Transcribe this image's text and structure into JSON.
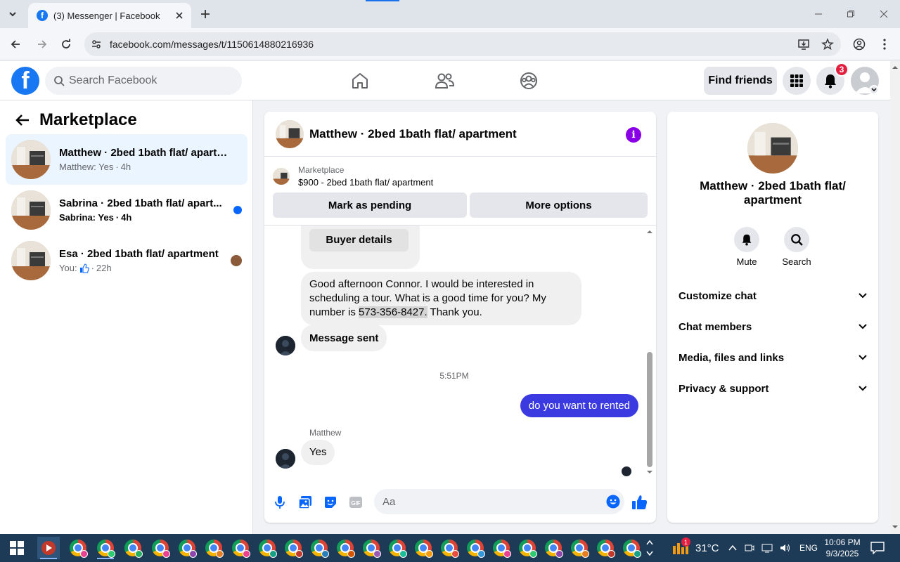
{
  "browser": {
    "tab_title": "(3) Messenger | Facebook",
    "url": "facebook.com/messages/t/1150614880216936"
  },
  "header": {
    "search_placeholder": "Search Facebook",
    "find_friends": "Find friends",
    "notifications_count": "3",
    "logo": "f"
  },
  "sidebar": {
    "title": "Marketplace",
    "conversations": [
      {
        "name": "Matthew · 2bed 1bath flat/ apartm...",
        "preview": "Matthew: Yes",
        "time": "4h",
        "active": true
      },
      {
        "name": "Sabrina · 2bed 1bath flat/ apart...",
        "preview": "Sabrina: Yes",
        "time": "4h",
        "unread": true
      },
      {
        "name": "Esa · 2bed 1bath flat/ apartment",
        "preview": "You:",
        "time": "22h",
        "read_receipt": true
      }
    ]
  },
  "chat": {
    "title": "Matthew · 2bed 1bath flat/ apartment",
    "marketplace_label": "Marketplace",
    "listing": "$900 - 2bed 1bath flat/ apartment",
    "mark_pending": "Mark as pending",
    "more_options": "More options",
    "buyer_details": "Buyer details",
    "message_1_pre": "Good afternoon Connor. I would be interested in scheduling a tour. What is a good time for you? My number is",
    "message_1_phone": "573-356-8427.",
    "message_1_post": "Thank you.",
    "message_2": "Message sent",
    "timestamp": "5:51PM",
    "outgoing": "do  you want to rented",
    "sender": "Matthew",
    "reply": "Yes",
    "composer_placeholder": "Aa"
  },
  "details": {
    "name": "Matthew · 2bed 1bath flat/ apartment",
    "mute": "Mute",
    "search": "Search",
    "sections": [
      "Customize chat",
      "Chat members",
      "Media, files and links",
      "Privacy & support"
    ]
  },
  "taskbar": {
    "temperature": "31°C",
    "language": "ENG",
    "time": "10:06 PM",
    "date": "9/3/2025",
    "weather_badge": "1"
  },
  "colors": {
    "fb_blue": "#1877f2",
    "outgoing_bubble": "#3a3ae0",
    "info_purple": "#8a00e6",
    "active_conv": "#ebf5ff"
  }
}
